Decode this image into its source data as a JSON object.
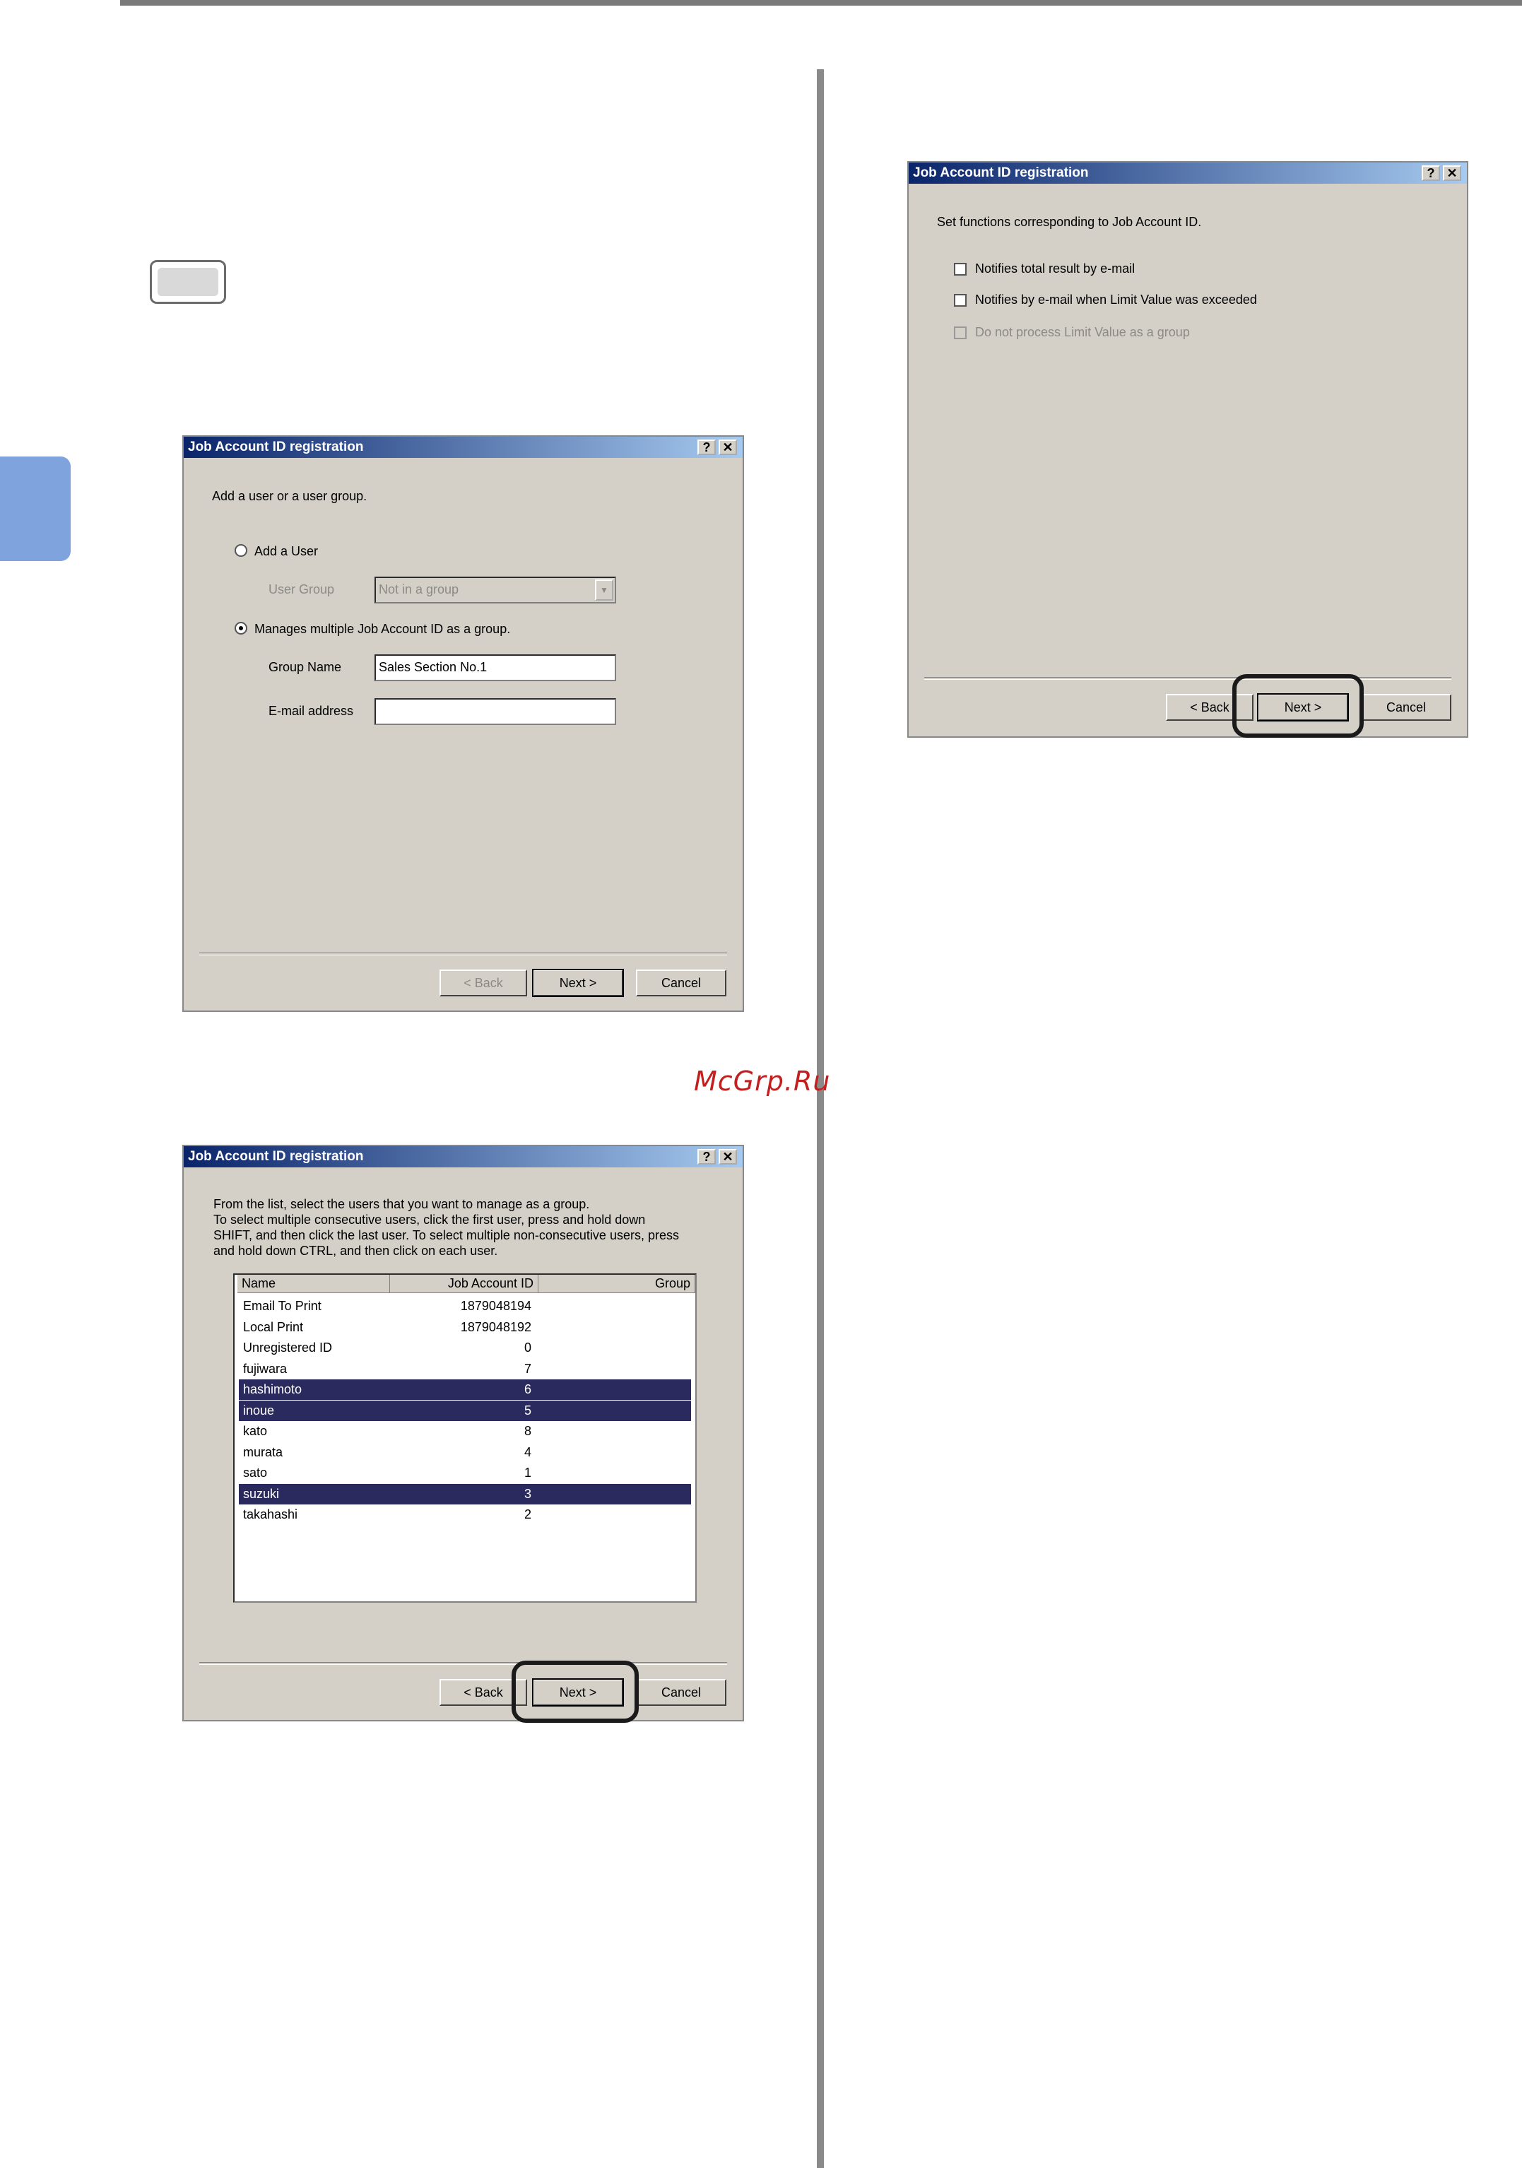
{
  "dialog_common": {
    "title": "Job Account ID registration",
    "help_glyph": "?",
    "close_glyph": "✕",
    "back_label": "< Back",
    "next_label": "Next >",
    "cancel_label": "Cancel"
  },
  "dialog1": {
    "instruction": "Add a user or a user group.",
    "radio_add_user": "Add a User",
    "user_group_label": "User Group",
    "user_group_value": "Not in a group",
    "radio_manage_group": "Manages multiple Job Account ID as a group.",
    "group_name_label": "Group Name",
    "group_name_value": "Sales Section No.1",
    "email_label": "E-mail address",
    "email_value": ""
  },
  "dialog2": {
    "instruction_lines": [
      "From the list, select the users that you want to manage as a group.",
      "To select multiple consecutive users, click the first user, press and hold down",
      "SHIFT, and then click the last user. To select multiple non-consecutive users, press",
      "and hold down CTRL, and then click on each user."
    ],
    "columns": [
      "Name",
      "Job Account ID",
      "Group"
    ],
    "rows": [
      {
        "name": "Email To Print",
        "id": "1879048194",
        "selected": false
      },
      {
        "name": "Local Print",
        "id": "1879048192",
        "selected": false
      },
      {
        "name": "Unregistered ID",
        "id": "0",
        "selected": false
      },
      {
        "name": "fujiwara",
        "id": "7",
        "selected": false
      },
      {
        "name": "hashimoto",
        "id": "6",
        "selected": true
      },
      {
        "name": "inoue",
        "id": "5",
        "selected": true
      },
      {
        "name": "kato",
        "id": "8",
        "selected": false
      },
      {
        "name": "murata",
        "id": "4",
        "selected": false
      },
      {
        "name": "sato",
        "id": "1",
        "selected": false
      },
      {
        "name": "suzuki",
        "id": "3",
        "selected": true
      },
      {
        "name": "takahashi",
        "id": "2",
        "selected": false
      }
    ]
  },
  "dialog3": {
    "instruction": "Set functions corresponding to Job Account ID.",
    "check_total_result": "Notifies total result by e-mail",
    "check_limit_exceeded": "Notifies by e-mail when Limit Value was exceeded",
    "check_no_group_limit": "Do not process Limit Value as a group"
  },
  "watermark": "McGrp.Ru"
}
